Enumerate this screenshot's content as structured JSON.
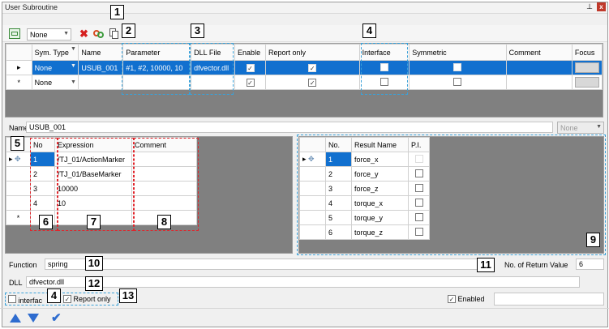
{
  "window": {
    "title": "User Subroutine",
    "pin_glyph": "⊥",
    "close_glyph": "x"
  },
  "toolbar": {
    "type_select": "None"
  },
  "callouts": {
    "c1": "1",
    "c2": "2",
    "c3": "3",
    "c4": "4",
    "c5": "5",
    "c6": "6",
    "c7": "7",
    "c8": "8",
    "c9": "9",
    "c10": "10",
    "c11": "11",
    "c12": "12",
    "c13": "13",
    "c4b": "4"
  },
  "main_grid": {
    "headers": [
      "Sym. Type",
      "Name",
      "Parameter",
      "DLL File",
      "Enable",
      "Report only",
      "Interface",
      "Symmetric",
      "Comment",
      "Focus"
    ],
    "rows": [
      {
        "marker": "▸",
        "sym_type": "None",
        "name": "USUB_001",
        "parameter": "#1, #2, 10000, 10",
        "dll": "dfvector.dll",
        "enable": "✓",
        "report_only": "✓",
        "interface": "",
        "symmetric": "",
        "comment": "",
        "focus": ""
      },
      {
        "marker": "*",
        "sym_type": "None",
        "name": "",
        "parameter": "",
        "dll": "",
        "enable": "✓",
        "report_only": "✓",
        "interface": "",
        "symmetric": "",
        "comment": "",
        "focus": ""
      }
    ]
  },
  "name_field": {
    "label": "Name",
    "value": "USUB_001",
    "type_value": "None"
  },
  "expr_grid": {
    "headers": [
      "No",
      "Expression",
      "Comment"
    ],
    "rows": [
      {
        "marker": "▸",
        "no": "1",
        "expression": "/TJ_01/ActionMarker",
        "comment": ""
      },
      {
        "marker": "",
        "no": "2",
        "expression": "/TJ_01/BaseMarker",
        "comment": ""
      },
      {
        "marker": "",
        "no": "3",
        "expression": "10000",
        "comment": ""
      },
      {
        "marker": "",
        "no": "4",
        "expression": "10",
        "comment": ""
      },
      {
        "marker": "*",
        "no": "",
        "expression": "",
        "comment": ""
      }
    ]
  },
  "result_grid": {
    "headers": [
      "No.",
      "Result Name",
      "P.I."
    ],
    "rows": [
      {
        "marker": "▸",
        "no": "1",
        "name": "force_x"
      },
      {
        "marker": "",
        "no": "2",
        "name": "force_y"
      },
      {
        "marker": "",
        "no": "3",
        "name": "force_z"
      },
      {
        "marker": "",
        "no": "4",
        "name": "torque_x"
      },
      {
        "marker": "",
        "no": "5",
        "name": "torque_y"
      },
      {
        "marker": "",
        "no": "6",
        "name": "torque_z"
      }
    ]
  },
  "function_field": {
    "label": "Function",
    "value": "spring"
  },
  "return_value": {
    "label": "No. of Return Value",
    "value": "6"
  },
  "dll_field": {
    "label": "DLL",
    "value": "dfvector.dll"
  },
  "options": {
    "interface_label": "interfac",
    "interface_checked": "",
    "report_only_label": "Report only",
    "report_only_checked": "✓",
    "enabled_label": "Enabled",
    "enabled_checked": "✓"
  },
  "colors": {
    "selection": "#1170cf",
    "callout_red": "#e0252b",
    "callout_blue": "#3aa1d8"
  }
}
